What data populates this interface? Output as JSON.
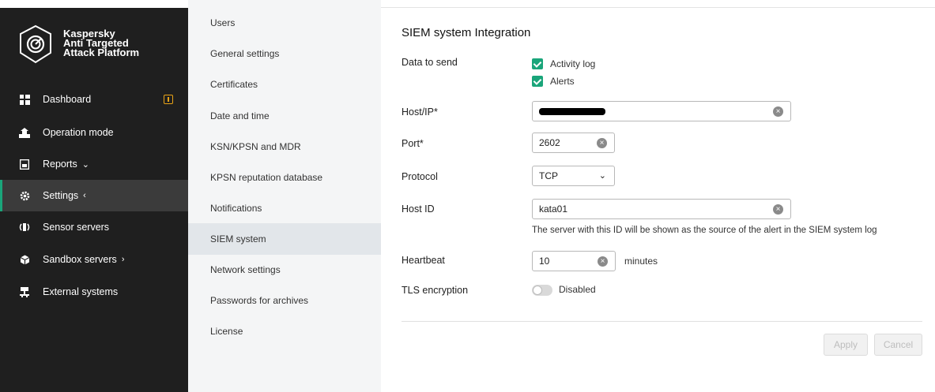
{
  "brand": {
    "line1": "Kaspersky",
    "line2": "Anti Targeted",
    "line3": "Attack Platform"
  },
  "nav": {
    "dashboard": "Dashboard",
    "operation_mode": "Operation mode",
    "reports": "Reports",
    "settings": "Settings",
    "sensor_servers": "Sensor servers",
    "sandbox_servers": "Sandbox servers",
    "external_systems": "External systems"
  },
  "submenu": {
    "users": "Users",
    "general": "General settings",
    "certificates": "Certificates",
    "datetime": "Date and time",
    "ksn": "KSN/KPSN and MDR",
    "kpsn_db": "KPSN reputation database",
    "notifications": "Notifications",
    "siem": "SIEM system",
    "network": "Network settings",
    "passwords": "Passwords for archives",
    "license": "License"
  },
  "form": {
    "title": "SIEM system Integration",
    "data_to_send_label": "Data to send",
    "activity_log": "Activity log",
    "alerts": "Alerts",
    "host_label": "Host/IP*",
    "port_label": "Port*",
    "port_value": "2602",
    "protocol_label": "Protocol",
    "protocol_value": "TCP",
    "host_id_label": "Host ID",
    "host_id_value": "kata01",
    "host_id_hint": "The server with this ID will be shown as the source of the alert in the SIEM system log",
    "heartbeat_label": "Heartbeat",
    "heartbeat_value": "10",
    "heartbeat_unit": "minutes",
    "tls_label": "TLS encryption",
    "tls_state": "Disabled",
    "apply": "Apply",
    "cancel": "Cancel"
  },
  "colors": {
    "accent": "#1aa57a",
    "sidebar_bg": "#1f1f1f",
    "badge": "#e8a317"
  }
}
